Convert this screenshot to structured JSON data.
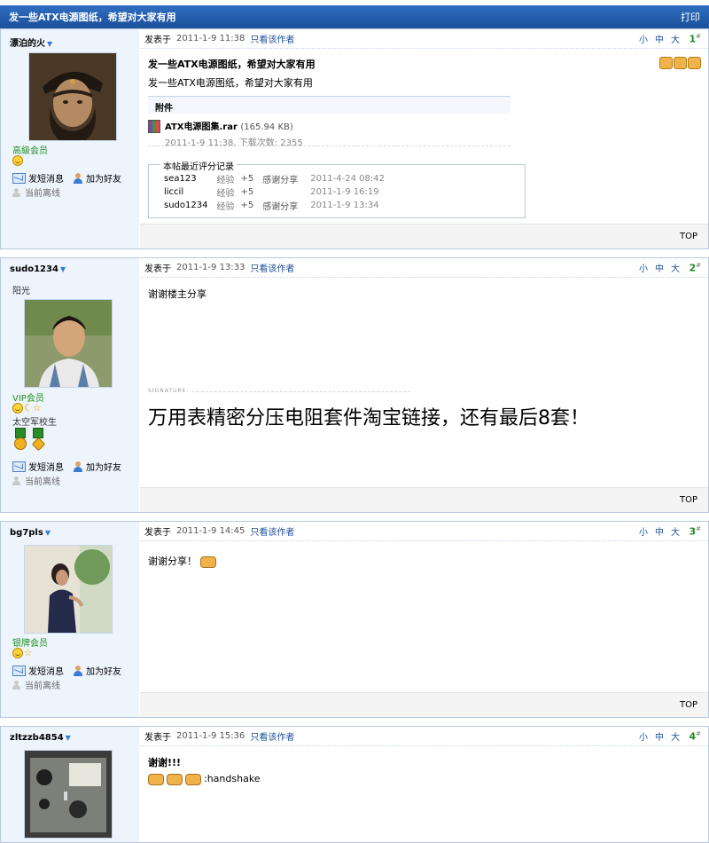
{
  "thread": {
    "title": "发一些ATX电源图纸，希望对大家有用",
    "print_label": "打印"
  },
  "labels": {
    "posted_at": "发表于",
    "only_author": "只看该作者",
    "font_small": "小",
    "font_medium": "中",
    "font_large": "大",
    "send_message": "发短消息",
    "add_friend": "加为好友",
    "offline": "当前离线",
    "top": "TOP",
    "attachment_head": "附件",
    "rating_title": "本帖最近评分记录",
    "signature_label": "SIGNATURE:"
  },
  "posts": [
    {
      "author": "漂泊的火",
      "group": "高級会员",
      "date": "2011-1-9 11:38",
      "floor": "1",
      "floor_sup": "#",
      "title": "发一些ATX电源图纸，希望对大家有用",
      "body": "发一些ATX电源图纸，希望对大家有用",
      "attachment": {
        "name": "ATX电源图集.rar",
        "size": "(165.94 KB)",
        "meta": "2011-1-9 11:38, 下载次数: 2355"
      },
      "ratings": [
        {
          "user": "sea123",
          "kind": "经验",
          "value": "+5",
          "reason": "感谢分享",
          "time": "2011-4-24 08:42"
        },
        {
          "user": "liccil",
          "kind": "经验",
          "value": "+5",
          "reason": "",
          "time": "2011-1-9 16:19"
        },
        {
          "user": "sudo1234",
          "kind": "经验",
          "value": "+5",
          "reason": "感谢分享",
          "time": "2011-1-9 13:34"
        }
      ]
    },
    {
      "author": "sudo1234",
      "custom_title": "阳光",
      "group": "VIP会员",
      "rank": "太空军校生",
      "date": "2011-1-9 13:33",
      "floor": "2",
      "floor_sup": "#",
      "body": "谢谢楼主分享",
      "signature": "万用表精密分压电阻套件淘宝链接，还有最后8套！"
    },
    {
      "author": "bg7pls",
      "group": "银牌会员",
      "date": "2011-1-9 14:45",
      "floor": "3",
      "floor_sup": "#",
      "body": "谢谢分享！"
    },
    {
      "author": "zltzzb4854",
      "date": "2011-1-9 15:36",
      "floor": "4",
      "floor_sup": "#",
      "body_title": "谢谢!!!",
      "body": ":handshake"
    }
  ]
}
